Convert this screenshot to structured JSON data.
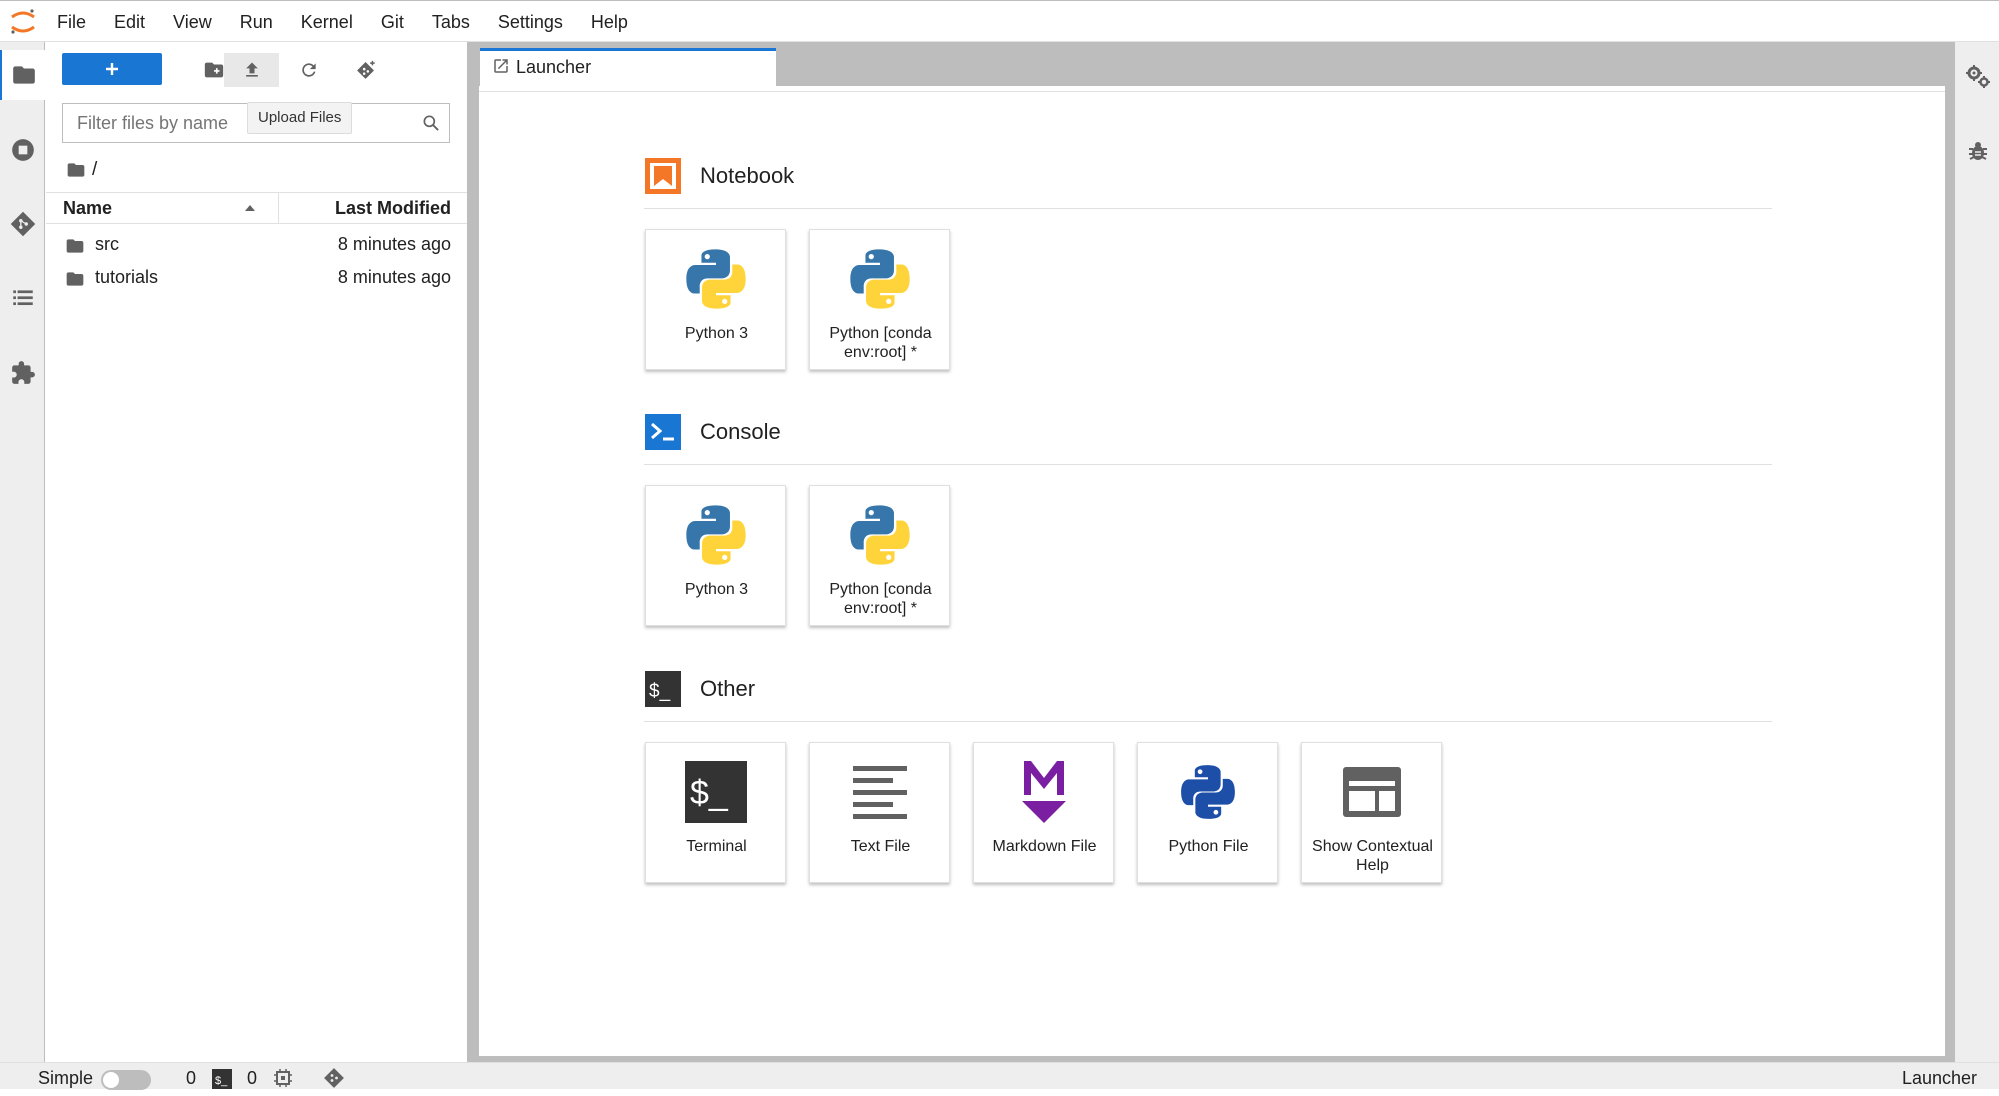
{
  "menubar": {
    "items": [
      "File",
      "Edit",
      "View",
      "Run",
      "Kernel",
      "Git",
      "Tabs",
      "Settings",
      "Help"
    ]
  },
  "filebrowser": {
    "search_placeholder": "Filter files by name",
    "tooltip": "Upload Files",
    "breadcrumb": "/",
    "columns": {
      "name": "Name",
      "modified": "Last Modified"
    },
    "files": [
      {
        "name": "src",
        "modified": "8 minutes ago"
      },
      {
        "name": "tutorials",
        "modified": "8 minutes ago"
      }
    ]
  },
  "dock": {
    "tab_label": "Launcher"
  },
  "launcher": {
    "sections": {
      "notebook": {
        "title": "Notebook",
        "items": [
          "Python 3",
          "Python [conda env:root] *"
        ]
      },
      "console": {
        "title": "Console",
        "items": [
          "Python 3",
          "Python [conda env:root] *"
        ]
      },
      "other": {
        "title": "Other",
        "items": [
          "Terminal",
          "Text File",
          "Markdown File",
          "Python File",
          "Show Contextual Help"
        ]
      }
    }
  },
  "statusbar": {
    "mode_label": "Simple",
    "kernels_count": "0",
    "terminals_count": "0",
    "right_label": "Launcher"
  },
  "colors": {
    "accent": "#1976d2",
    "notebook_icon": "#f37726",
    "markdown_icon": "#7b1fa2",
    "python_blue": "#3776ab",
    "python_yellow": "#ffd43b"
  }
}
